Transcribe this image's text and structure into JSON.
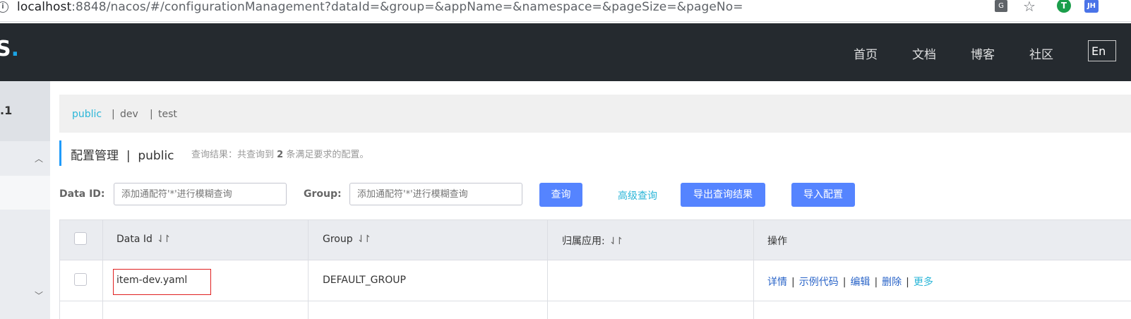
{
  "browser": {
    "url_host": "localhost",
    "url_rest": ":8848/nacos/#/configurationManagement?dataId=&group=&appName=&namespace=&pageSize=&pageNo=",
    "profile_initials": "JH",
    "icons": [
      "info-icon",
      "translate-icon",
      "star-icon",
      "extension-icon",
      "profile-avatar"
    ]
  },
  "topnav": {
    "logo_text": "S",
    "links": [
      "首页",
      "文档",
      "博客",
      "社区"
    ],
    "lang_button": "En"
  },
  "sidebar": {
    "version": ".1"
  },
  "namespaces": [
    {
      "label": "public",
      "active": true
    },
    {
      "label": "dev",
      "active": false
    },
    {
      "label": "test",
      "active": false
    }
  ],
  "page": {
    "title": "配置管理",
    "title_separator": "|",
    "title_namespace": "public",
    "summary_prefix": "查询结果：共查询到",
    "summary_count": "2",
    "summary_suffix": "条满足要求的配置。"
  },
  "search": {
    "dataid_label": "Data ID:",
    "dataid_placeholder": "添加通配符'*'进行模糊查询",
    "group_label": "Group:",
    "group_placeholder": "添加通配符'*'进行模糊查询",
    "query_button": "查询",
    "advanced_link": "高级查询",
    "export_button": "导出查询结果",
    "import_button": "导入配置"
  },
  "table": {
    "headers": {
      "data_id": "Data Id",
      "group": "Group",
      "app": "归属应用:",
      "ops": "操作"
    },
    "sort_icon": "⇃↾",
    "rows": [
      {
        "data_id": "item-dev.yaml",
        "group": "DEFAULT_GROUP",
        "app": ""
      }
    ],
    "ops": {
      "detail": "详情",
      "sample_code": "示例代码",
      "edit": "编辑",
      "delete": "删除",
      "more": "更多",
      "separator": "|"
    }
  },
  "colors": {
    "nav_bg": "#252a2f",
    "primary_button": "#5584ff",
    "link": "#2a64c8",
    "active_ns": "#2bb6d8",
    "highlight_border": "#e02020"
  }
}
